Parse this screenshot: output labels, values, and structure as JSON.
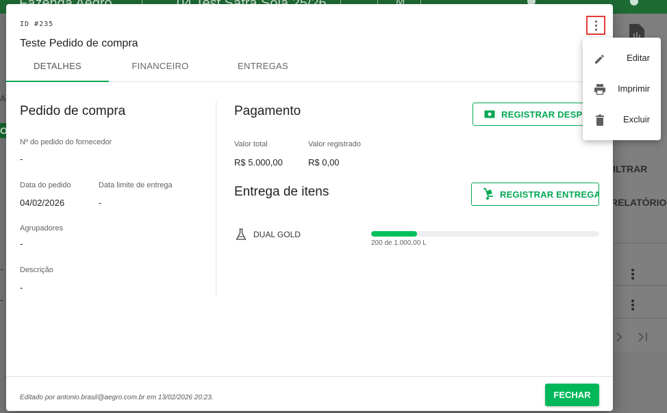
{
  "background": {
    "topbar_texts": [
      "Fazenda Aegro",
      "04 Test Safra Soja 25/26",
      "M"
    ],
    "filter_label": "ILTRAR",
    "report_label": "RELATÓRIO",
    "left_fragment_1": "AÇ",
    "left_fragment_2": "O",
    "dash": "-"
  },
  "modal": {
    "id_label": "ID #235",
    "title": "Teste Pedido de compra",
    "tabs": [
      "DETALHES",
      "FINANCEIRO",
      "ENTREGAS"
    ],
    "active_tab": "DETALHES",
    "purchase_order": {
      "heading": "Pedido de compra",
      "supplier_order_label": "Nº do pedido do fornecedor",
      "supplier_order_value": "-",
      "order_date_label": "Data do pedido",
      "order_date_value": "04/02/2026",
      "deadline_label": "Data limite de entrega",
      "deadline_value": "-",
      "groupers_label": "Agrupadores",
      "groupers_value": "-",
      "description_label": "Descrição",
      "description_value": "-"
    },
    "payment": {
      "heading": "Pagamento",
      "register_expense_button": "REGISTRAR DESPESA",
      "total_label": "Valor total",
      "total_value": "R$ 5.000,00",
      "registered_label": "Valor registrado",
      "registered_value": "R$ 0,00"
    },
    "delivery": {
      "heading": "Entrega de itens",
      "register_delivery_button": "REGISTRAR ENTREGA",
      "items": [
        {
          "name": "DUAL GOLD",
          "icon": "flask-icon",
          "progress_text": "200 de 1.000,00 L",
          "progress_fraction": 0.2
        }
      ]
    },
    "footer": {
      "edited_by": "Editado por antonio.brasil@aegro.com.br em 13/02/2026 20:23.",
      "close_button": "FECHAR"
    }
  },
  "menu": {
    "items": [
      {
        "label": "Editar",
        "icon": "pencil-icon"
      },
      {
        "label": "Imprimir",
        "icon": "printer-icon"
      },
      {
        "label": "Excluir",
        "icon": "trash-icon"
      }
    ]
  },
  "colors": {
    "accent_green": "#00a852",
    "progress_green": "#00c05a",
    "highlight_red": "#e53935"
  }
}
